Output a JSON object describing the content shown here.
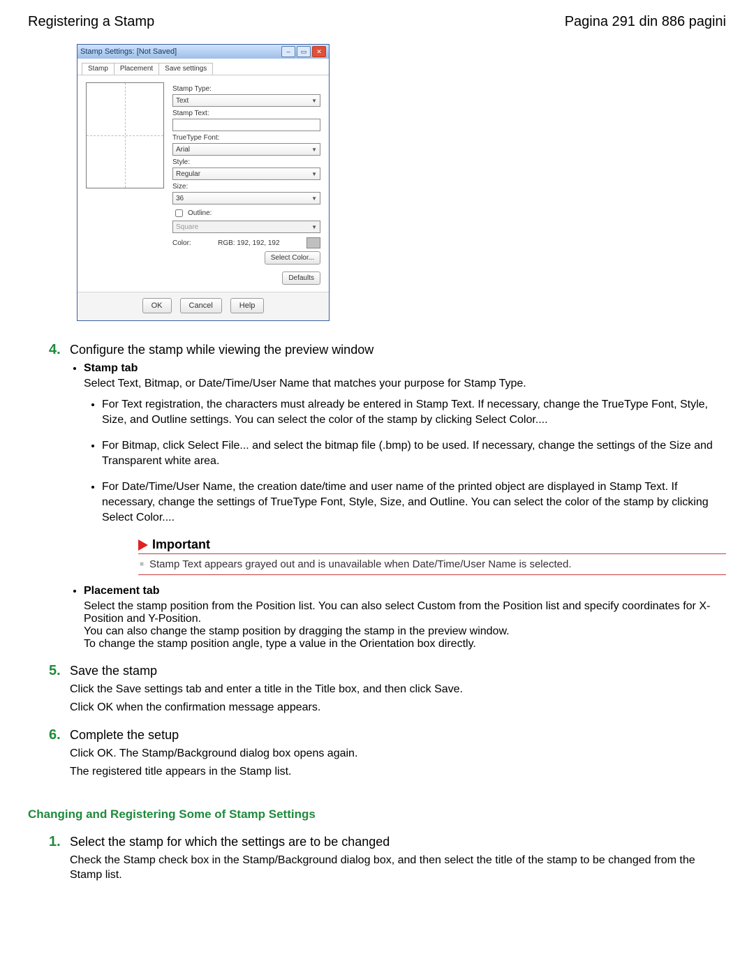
{
  "header": {
    "title": "Registering a Stamp",
    "page_info": "Pagina 291 din 886 pagini"
  },
  "dialog": {
    "title": "Stamp Settings: [Not Saved]",
    "tabs": {
      "t0": "Stamp",
      "t1": "Placement",
      "t2": "Save settings"
    },
    "labels": {
      "stamp_type": "Stamp Type:",
      "stamp_text": "Stamp Text:",
      "font": "TrueType Font:",
      "style": "Style:",
      "size": "Size:",
      "outline_chk": "Outline:",
      "color": "Color:"
    },
    "values": {
      "stamp_type": "Text",
      "stamp_text": "",
      "font": "Arial",
      "style": "Regular",
      "size": "36",
      "outline": "Square",
      "rgb": "RGB: 192, 192, 192"
    },
    "buttons": {
      "select_color": "Select Color...",
      "defaults": "Defaults",
      "ok": "OK",
      "cancel": "Cancel",
      "help": "Help"
    }
  },
  "steps": {
    "s4": {
      "num": "4.",
      "title": "Configure the stamp while viewing the preview window",
      "stamp_tab_label": "Stamp tab",
      "stamp_tab_desc": "Select Text, Bitmap, or Date/Time/User Name that matches your purpose for Stamp Type.",
      "sub1": "For Text registration, the characters must already be entered in Stamp Text. If necessary, change the TrueType Font, Style, Size, and Outline settings. You can select the color of the stamp by clicking Select Color....",
      "sub2": "For Bitmap, click Select File... and select the bitmap file (.bmp) to be used. If necessary, change the settings of the Size and Transparent white area.",
      "sub3": "For Date/Time/User Name, the creation date/time and user name of the printed object are displayed in Stamp Text. If necessary, change the settings of TrueType Font, Style, Size, and Outline. You can select the color of the stamp by clicking Select Color....",
      "important_label": "Important",
      "important_text": "Stamp Text appears grayed out and is unavailable when Date/Time/User Name is selected.",
      "placement_tab_label": "Placement tab",
      "placement_desc1": "Select the stamp position from the Position list. You can also select Custom from the Position list and specify coordinates for X-Position and Y-Position.",
      "placement_desc2": "You can also change the stamp position by dragging the stamp in the preview window.",
      "placement_desc3": "To change the stamp position angle, type a value in the Orientation box directly."
    },
    "s5": {
      "num": "5.",
      "title": "Save the stamp",
      "body1": "Click the Save settings tab and enter a title in the Title box, and then click Save.",
      "body2": "Click OK when the confirmation message appears."
    },
    "s6": {
      "num": "6.",
      "title": "Complete the setup",
      "body1": "Click OK. The Stamp/Background dialog box opens again.",
      "body2": "The registered title appears in the Stamp list."
    }
  },
  "section2": {
    "heading": "Changing and Registering Some of Stamp Settings",
    "s1": {
      "num": "1.",
      "title": "Select the stamp for which the settings are to be changed",
      "body": "Check the Stamp check box in the Stamp/Background dialog box, and then select the title of the stamp to be changed from the Stamp list."
    }
  }
}
